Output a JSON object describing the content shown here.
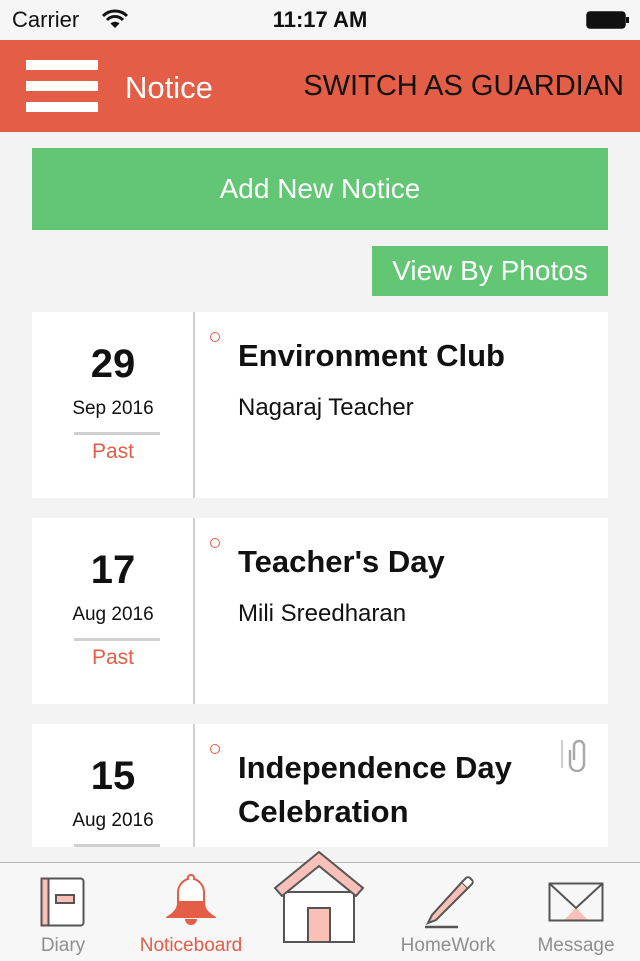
{
  "status_bar": {
    "carrier": "Carrier",
    "time": "11:17 AM"
  },
  "navbar": {
    "title": "Notice",
    "switch_label": "SWITCH AS GUARDIAN"
  },
  "actions": {
    "add_notice": "Add New Notice",
    "view_photos": "View By Photos"
  },
  "colors": {
    "primary": "#e35d47",
    "green": "#63c674",
    "tab_inactive": "#8e8e8e"
  },
  "notices": [
    {
      "day": "29",
      "month_year": "Sep 2016",
      "status": "Past",
      "title": "Environment Club",
      "author": "Nagaraj Teacher",
      "attachment": false
    },
    {
      "day": "17",
      "month_year": "Aug 2016",
      "status": "Past",
      "title": "Teacher's Day",
      "author": "Mili Sreedharan",
      "attachment": false
    },
    {
      "day": "15",
      "month_year": "Aug 2016",
      "status": "",
      "title": "Independence Day Celebration",
      "author": "",
      "attachment": true
    }
  ],
  "tabs": [
    {
      "label": "Diary",
      "icon": "diary-icon",
      "active": false
    },
    {
      "label": "Noticeboard",
      "icon": "bell-icon",
      "active": true
    },
    {
      "label": "",
      "icon": "home-icon",
      "active": false
    },
    {
      "label": "HomeWork",
      "icon": "pencil-icon",
      "active": false
    },
    {
      "label": "Message",
      "icon": "envelope-icon",
      "active": false
    }
  ]
}
